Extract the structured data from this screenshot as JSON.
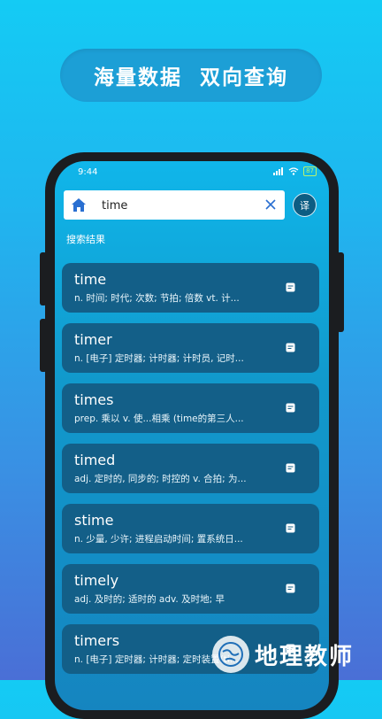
{
  "banner": {
    "title": "海量数据  双向查询"
  },
  "status_bar": {
    "time": "9:44",
    "battery": "87"
  },
  "search": {
    "value": "time",
    "translate_label": "译"
  },
  "section": {
    "label": "搜索结果"
  },
  "results": [
    {
      "word": "time",
      "definition": "n. 时间; 时代; 次数; 节拍; 倍数 vt. 计..."
    },
    {
      "word": "timer",
      "definition": "n. [电子] 定时器; 计时器; 计时员, 记时..."
    },
    {
      "word": "times",
      "definition": "prep. 乘以 v. 使...相乘 (time的第三人..."
    },
    {
      "word": "timed",
      "definition": "adj. 定时的, 同步的; 时控的 v. 合拍; 为..."
    },
    {
      "word": "stime",
      "definition": "n. 少量, 少许; 进程启动时间; 置系统日..."
    },
    {
      "word": "timely",
      "definition": "adj. 及时的; 适时的 adv. 及时地; 早"
    },
    {
      "word": "timers",
      "definition": "n. [电子] 定时器; 计时器; 定时装置(ti..."
    }
  ],
  "watermark": {
    "text": "地理教师"
  },
  "colors": {
    "accent": "#135f88",
    "background_top": "#14cbf4",
    "background_bottom": "#4a6fd6"
  }
}
